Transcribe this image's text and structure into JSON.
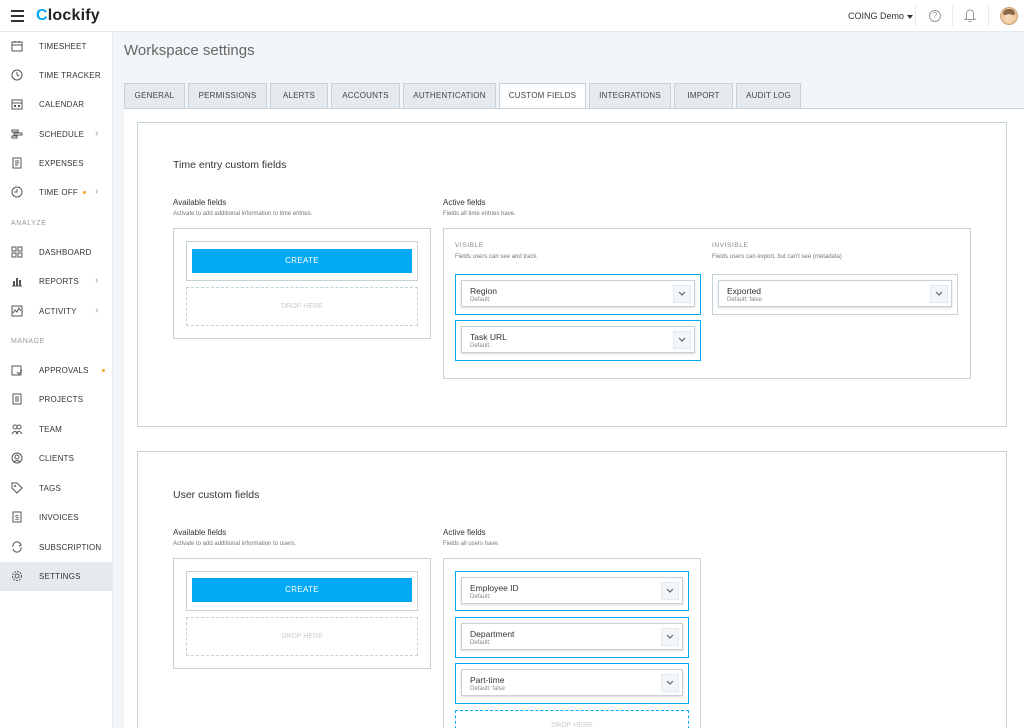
{
  "app": {
    "logo_rest": "lockify",
    "logo_c": "C",
    "workspace_name": "COING Demo"
  },
  "sidebar": {
    "timesheet": "TIMESHEET",
    "time_tracker": "TIME TRACKER",
    "calendar": "CALENDAR",
    "schedule": "SCHEDULE",
    "expenses": "EXPENSES",
    "time_off": "TIME OFF",
    "analyze_section": "ANALYZE",
    "dashboard": "DASHBOARD",
    "reports": "REPORTS",
    "activity": "ACTIVITY",
    "manage_section": "MANAGE",
    "approvals": "APPROVALS",
    "projects": "PROJECTS",
    "team": "TEAM",
    "clients": "CLIENTS",
    "tags": "TAGS",
    "invoices": "INVOICES",
    "subscription": "SUBSCRIPTION",
    "settings": "SETTINGS"
  },
  "page": {
    "title": "Workspace settings"
  },
  "tabs": {
    "general": "GENERAL",
    "permissions": "PERMISSIONS",
    "alerts": "ALERTS",
    "accounts": "ACCOUNTS",
    "authentication": "AUTHENTICATION",
    "custom_fields": "CUSTOM FIELDS",
    "integrations": "INTEGRATIONS",
    "import": "IMPORT",
    "audit_log": "AUDIT LOG"
  },
  "time_entry": {
    "title": "Time entry custom fields",
    "available_title": "Available fields",
    "available_sub": "Activate to add additional information to time entries.",
    "active_title": "Active fields",
    "active_sub": "Fields all time entries have.",
    "create_label": "CREATE",
    "drop_label": "DROP HERE",
    "visible_title": "VISIBLE",
    "visible_sub": "Fields users can see and track.",
    "invisible_title": "INVISIBLE",
    "invisible_sub": "Fields users can export, but can't see (metadata)",
    "region": {
      "name": "Region",
      "default": "Default:"
    },
    "task_url": {
      "name": "Task URL",
      "default": "Default:"
    },
    "exported": {
      "name": "Exported",
      "default": "Default: false"
    }
  },
  "user_fields": {
    "title": "User custom fields",
    "available_title": "Available fields",
    "available_sub": "Activate to add additional information to users.",
    "active_title": "Active fields",
    "active_sub": "Fields all users have.",
    "create_label": "CREATE",
    "drop_label": "DROP HERE",
    "employee_id": {
      "name": "Employee ID",
      "default": "Default:"
    },
    "department": {
      "name": "Department",
      "default": "Default:"
    },
    "part_time": {
      "name": "Part-time",
      "default": "Default: false"
    },
    "active_drop_label": "DROP HERE"
  },
  "colors": {
    "accent": "#03a9f4",
    "dot": "#f5a623",
    "bg": "#f2f6f8"
  }
}
